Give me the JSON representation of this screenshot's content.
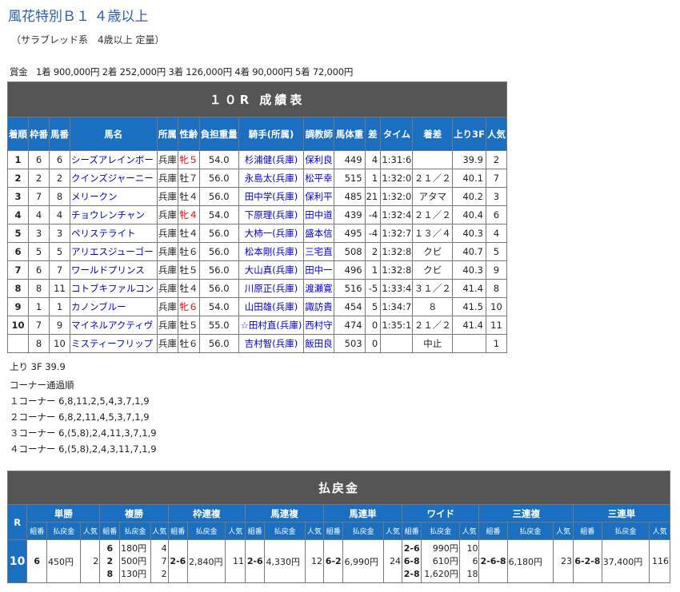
{
  "race": {
    "title": "風花特別Ｂ１ ４歳以上",
    "subtitle": "（サラブレッド系　4歳以上 定量）",
    "prize_label": "賞金",
    "prize_text": "1着 900,000円 2着 252,000円 3着 126,000円 4着 90,000円 5着 72,000円"
  },
  "results": {
    "title": "１０R 成績表",
    "headers": [
      "着順",
      "枠番",
      "馬番",
      "馬名",
      "所属",
      "性齢",
      "負担重量",
      "騎手(所属)",
      "調教師",
      "馬体重",
      "差",
      "タイム",
      "着差",
      "上り3F",
      "人気"
    ],
    "rows": [
      [
        "1",
        "6",
        "6",
        "シーズアレインボー",
        "兵庫",
        "牝５",
        "54.0",
        "杉浦健(兵庫)",
        "保利良",
        "449",
        "4",
        "1:31:6",
        "",
        "39.9",
        "2"
      ],
      [
        "2",
        "2",
        "2",
        "クインズジャーニー",
        "兵庫",
        "牡７",
        "56.0",
        "永島太(兵庫)",
        "松平幸",
        "515",
        "1",
        "1:32:0",
        "２１／２",
        "40.1",
        "7"
      ],
      [
        "3",
        "7",
        "8",
        "メリークン",
        "兵庫",
        "牡４",
        "56.0",
        "田中学(兵庫)",
        "保利平",
        "485",
        "21",
        "1:32:0",
        "アタマ",
        "40.2",
        "3"
      ],
      [
        "4",
        "4",
        "4",
        "チョウレンチャン",
        "兵庫",
        "牝４",
        "54.0",
        "下原理(兵庫)",
        "田中道",
        "439",
        "-4",
        "1:32:4",
        "２１／２",
        "40.4",
        "6"
      ],
      [
        "5",
        "3",
        "3",
        "ペリステライト",
        "兵庫",
        "牡４",
        "56.0",
        "大柿一(兵庫)",
        "盛本信",
        "495",
        "-4",
        "1:32:7",
        "１３／４",
        "40.3",
        "4"
      ],
      [
        "6",
        "5",
        "5",
        "アリエスジューゴー",
        "兵庫",
        "牡６",
        "56.0",
        "松本剛(兵庫)",
        "三宅直",
        "508",
        "2",
        "1:32:8",
        "クビ",
        "40.7",
        "5"
      ],
      [
        "7",
        "6",
        "7",
        "ワールドプリンス",
        "兵庫",
        "牡５",
        "56.0",
        "大山真(兵庫)",
        "田中一",
        "496",
        "1",
        "1:32:8",
        "クビ",
        "40.3",
        "9"
      ],
      [
        "8",
        "8",
        "11",
        "コトブキファルコン",
        "兵庫",
        "牡４",
        "56.0",
        "川原正(兵庫)",
        "渡瀬寛",
        "516",
        "-5",
        "1:33:4",
        "３１／２",
        "41.4",
        "8"
      ],
      [
        "9",
        "1",
        "1",
        "カノンブルー",
        "兵庫",
        "牝６",
        "54.0",
        "山田雄(兵庫)",
        "諏訪貴",
        "454",
        "5",
        "1:34:7",
        "８",
        "41.5",
        "10"
      ],
      [
        "10",
        "7",
        "9",
        "マイネルアクティヴ",
        "兵庫",
        "牡５",
        "55.0",
        "☆田村直(兵庫)",
        "西村守",
        "474",
        "0",
        "1:35:1",
        "２１／２",
        "41.4",
        "11"
      ],
      [
        "",
        "8",
        "10",
        "ミスティーフリップ",
        "兵庫",
        "牡６",
        "56.0",
        "吉村智(兵庫)",
        "飯田良",
        "503",
        "0",
        "",
        "中止",
        "",
        "1"
      ]
    ]
  },
  "agari": "上り 3F 39.9",
  "corners": {
    "title": "コーナー通過順",
    "lines": [
      "１コーナー 6,8,11,2,5,4,3,7,1,9",
      "２コーナー 6,8,2,11,4,5,3,7,1,9",
      "３コーナー 6,(5,8),2,4,11,3,7,1,9",
      "４コーナー 6,(5,8),2,4,3,11,7,1,9"
    ]
  },
  "payout": {
    "title": "払戻金",
    "r_label": "R",
    "race_no": "10",
    "bet_types": [
      "単勝",
      "複勝",
      "枠連複",
      "馬連複",
      "馬連単",
      "ワイド",
      "三連複",
      "三連単"
    ],
    "sub_headers": [
      "組番",
      "払戻金",
      "人気"
    ],
    "tansho": {
      "combo": "6",
      "pay": "450円",
      "pop": "2"
    },
    "fukusho": [
      {
        "combo": "6",
        "pay": "180円",
        "pop": "4"
      },
      {
        "combo": "2",
        "pay": "500円",
        "pop": "7"
      },
      {
        "combo": "8",
        "pay": "130円",
        "pop": "2"
      }
    ],
    "wakuren": {
      "combo": "2-6",
      "pay": "2,840円",
      "pop": "11"
    },
    "umaren": {
      "combo": "2-6",
      "pay": "4,330円",
      "pop": "12"
    },
    "umatan": {
      "combo": "6-2",
      "pay": "6,990円",
      "pop": "24"
    },
    "wide": [
      {
        "combo": "2-6",
        "pay": "990円",
        "pop": "10"
      },
      {
        "combo": "6-8",
        "pay": "610円",
        "pop": "6"
      },
      {
        "combo": "2-8",
        "pay": "1,620円",
        "pop": "18"
      }
    ],
    "sanrenpuku": {
      "combo": "2-6-8",
      "pay": "6,180円",
      "pop": "23"
    },
    "sanrentan": {
      "combo": "6-2-8",
      "pay": "37,400円",
      "pop": "116"
    }
  },
  "colors": {
    "header_blue": "#1a6fc0",
    "bar_gray": "#555555",
    "title_blue": "#2a5fae",
    "mare_red": "#dd0000",
    "link_blue": "#0000cc"
  }
}
